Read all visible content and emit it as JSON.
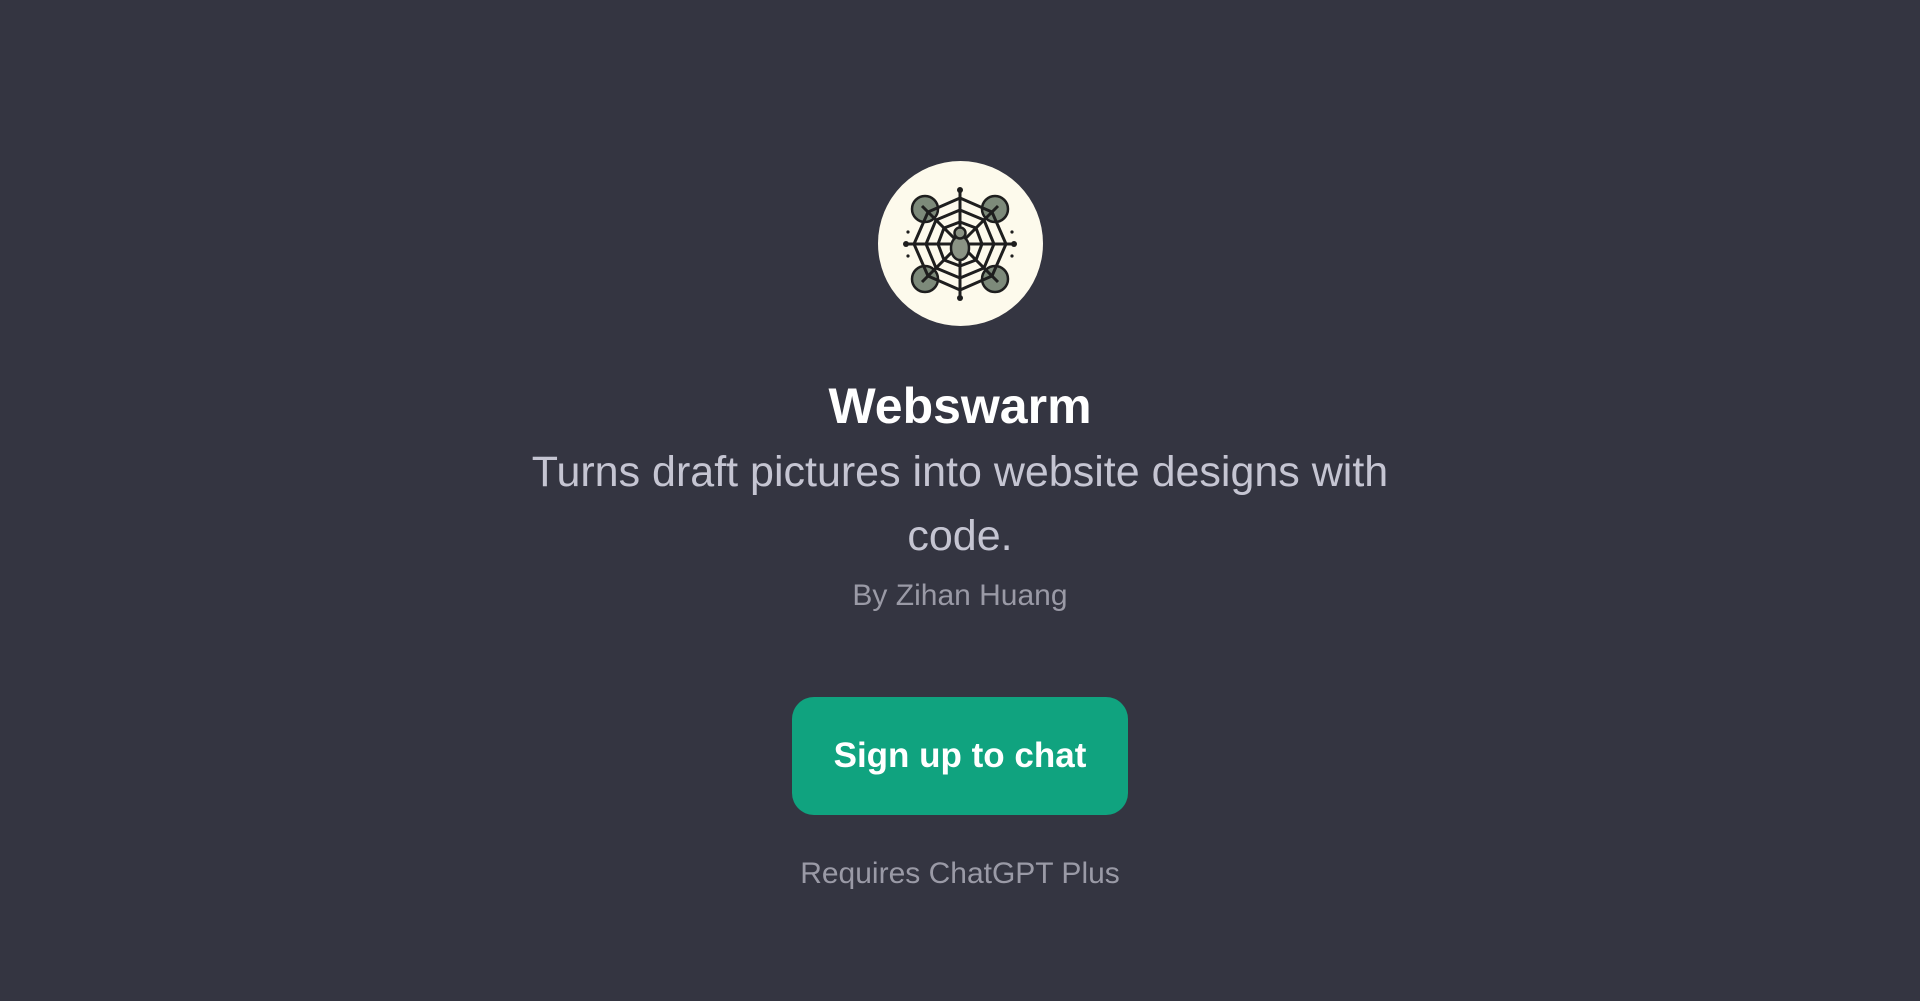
{
  "gpt": {
    "icon": "spider-web-icon",
    "name": "Webswarm",
    "description": "Turns draft pictures into website designs with code.",
    "author": "By Zihan Huang"
  },
  "actions": {
    "signup_label": "Sign up to chat"
  },
  "footer": {
    "requirement": "Requires ChatGPT Plus"
  },
  "colors": {
    "background": "#343541",
    "avatar_bg": "#fdfaec",
    "button": "#10a37f",
    "title": "#ffffff",
    "description": "#c5c5d2",
    "muted": "#9a9aa6"
  }
}
